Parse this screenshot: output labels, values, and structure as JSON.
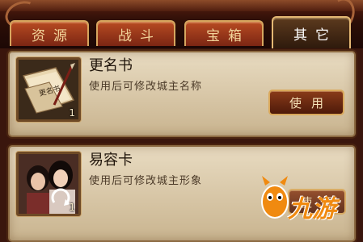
{
  "tabs": [
    {
      "label": "资源",
      "active": false
    },
    {
      "label": "战斗",
      "active": false
    },
    {
      "label": "宝箱",
      "active": false
    },
    {
      "label": "其它",
      "active": true
    }
  ],
  "items": [
    {
      "name": "更名书",
      "description": "使用后可修改城主名称",
      "quantity": "1",
      "button": "使用",
      "icon": "rename-book-icon"
    },
    {
      "name": "易容卡",
      "description": "使用后可修改城主形象",
      "quantity": "1",
      "button": "使用",
      "icon": "disguise-card-icon"
    }
  ],
  "watermark": {
    "text": "九游"
  },
  "colors": {
    "tab_active_text": "#ffffff",
    "tab_text": "#f2d49a",
    "panel_bg": "#e8dbc1",
    "button_bg": "#8a3b19",
    "watermark": "#f08a10"
  }
}
